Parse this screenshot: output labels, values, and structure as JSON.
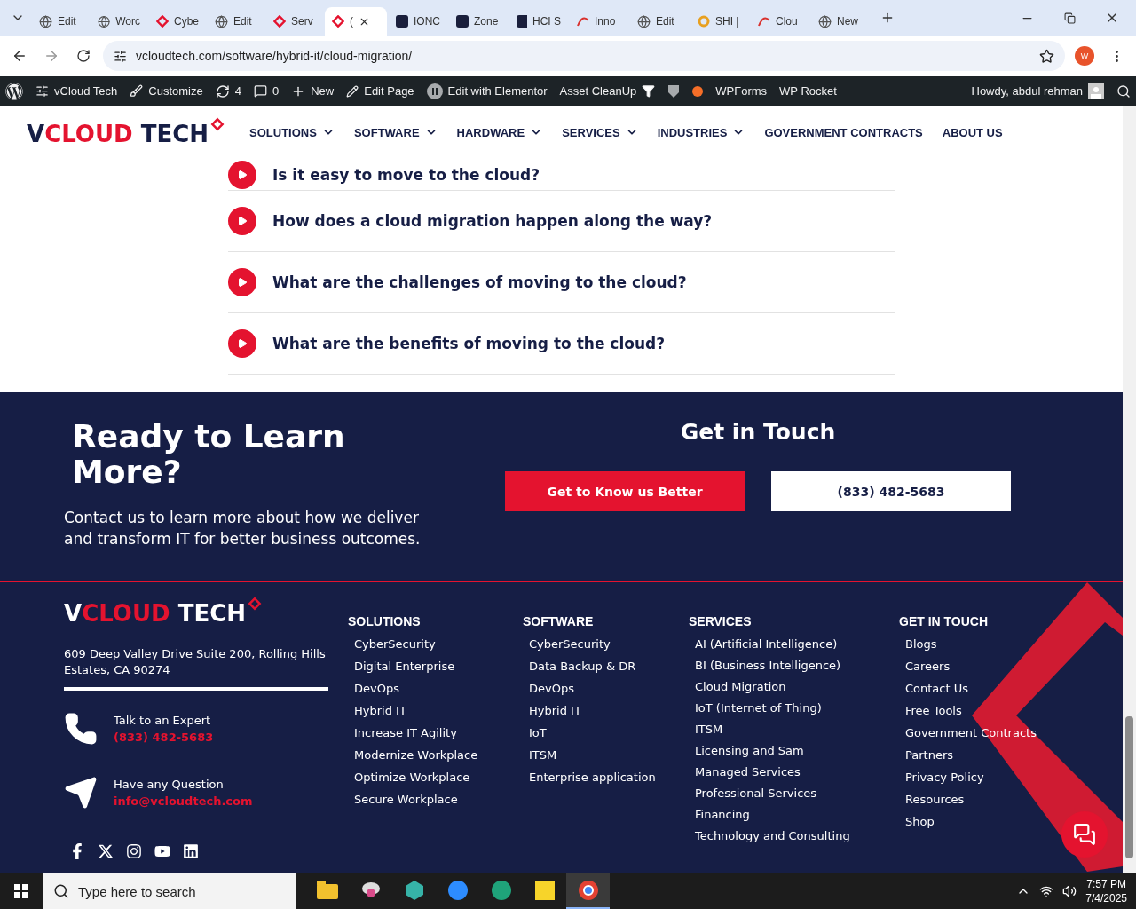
{
  "browser": {
    "tabs": [
      {
        "label": "Edit",
        "selected": false
      },
      {
        "label": "Worc",
        "selected": false
      },
      {
        "label": "Cybe",
        "selected": false
      },
      {
        "label": "Edit",
        "selected": false
      },
      {
        "label": "Serv",
        "selected": false
      },
      {
        "label": "(",
        "selected": true
      },
      {
        "label": "IONC",
        "selected": false
      },
      {
        "label": "Zone",
        "selected": false
      },
      {
        "label": "HCI S",
        "selected": false
      },
      {
        "label": "Inno",
        "selected": false
      },
      {
        "label": "Edit",
        "selected": false
      },
      {
        "label": "SHI |",
        "selected": false
      },
      {
        "label": "Clou",
        "selected": false
      },
      {
        "label": "New",
        "selected": false
      }
    ],
    "address": "vcloudtech.com/software/hybrid-it/cloud-migration/",
    "profile": "W"
  },
  "admin_bar": {
    "site": "vCloud Tech",
    "customize": "Customize",
    "updates": "4",
    "comments": "0",
    "new": "New",
    "edit_page": "Edit Page",
    "elementor": "Edit with Elementor",
    "asset_cleanup": "Asset CleanUp",
    "wpforms": "WPForms",
    "wp_rocket": "WP Rocket",
    "greeting": "Howdy, abdul rehman"
  },
  "site_nav": {
    "logo": {
      "lead": "V",
      "accent": "CLOUD",
      "tail": "TECH"
    },
    "items": [
      {
        "label": "SOLUTIONS",
        "has_menu": true
      },
      {
        "label": "SOFTWARE",
        "has_menu": true
      },
      {
        "label": "HARDWARE",
        "has_menu": true
      },
      {
        "label": "SERVICES",
        "has_menu": true
      },
      {
        "label": "INDUSTRIES",
        "has_menu": true
      },
      {
        "label": "GOVERNMENT CONTRACTS",
        "has_menu": false
      },
      {
        "label": "ABOUT US",
        "has_menu": false
      }
    ]
  },
  "faq": [
    "Is it easy to move to the cloud?",
    "How does a cloud migration happen along the way?",
    "What are the challenges of moving to the cloud?",
    "What are the benefits of moving to the cloud?"
  ],
  "cta": {
    "heading": "Ready to Learn More?",
    "text": "Contact us to learn more about how we deliver and transform IT for better business outcomes.",
    "get_in_touch": "Get in Touch",
    "primary_button": "Get to Know us Better",
    "phone_button": "(833) 482-5683"
  },
  "footer": {
    "logo": {
      "lead": "V",
      "accent": "CLOUD",
      "tail": "TECH"
    },
    "address": "609 Deep Valley Drive Suite 200, Rolling Hills Estates, CA 90274",
    "contacts": [
      {
        "kind": "phone",
        "label": "Talk to an Expert",
        "value": "(833) 482-5683"
      },
      {
        "kind": "mail",
        "label": "Have any Question",
        "value": "info@vcloudtech.com"
      }
    ],
    "columns": [
      {
        "title": "SOLUTIONS",
        "links": [
          "CyberSecurity",
          "Digital Enterprise",
          "DevOps",
          "Hybrid IT",
          "Increase IT Agility",
          "Modernize Workplace",
          "Optimize Workplace",
          "Secure Workplace"
        ]
      },
      {
        "title": "SOFTWARE",
        "links": [
          "CyberSecurity",
          "Data Backup & DR",
          "DevOps",
          "Hybrid IT",
          "IoT",
          "ITSM",
          "Enterprise application"
        ]
      },
      {
        "title": "SERVICES",
        "links": [
          "AI (Artificial Intelligence)",
          "BI (Business Intelligence)",
          "Cloud Migration",
          "IoT (Internet of Thing)",
          "ITSM",
          "Licensing and Sam",
          "Managed Services",
          "Professional Services",
          "Financing",
          "Technology and Consulting"
        ]
      },
      {
        "title": "GET IN TOUCH",
        "links": [
          "Blogs",
          "Careers",
          "Contact Us",
          "Free Tools",
          "Government Contracts",
          "Partners",
          "Privacy Policy",
          "Resources",
          "Shop"
        ]
      }
    ]
  },
  "taskbar": {
    "search_placeholder": "Type here to search",
    "apps": [
      {
        "kind": "folder",
        "active": false
      },
      {
        "kind": "snip",
        "active": false
      },
      {
        "kind": "hex",
        "active": false
      },
      {
        "kind": "zoom",
        "active": false
      },
      {
        "kind": "edge",
        "active": false
      },
      {
        "kind": "notes",
        "active": false
      },
      {
        "kind": "chrome",
        "active": true
      }
    ],
    "time": "7:57 PM",
    "date": "7/4/2025"
  }
}
